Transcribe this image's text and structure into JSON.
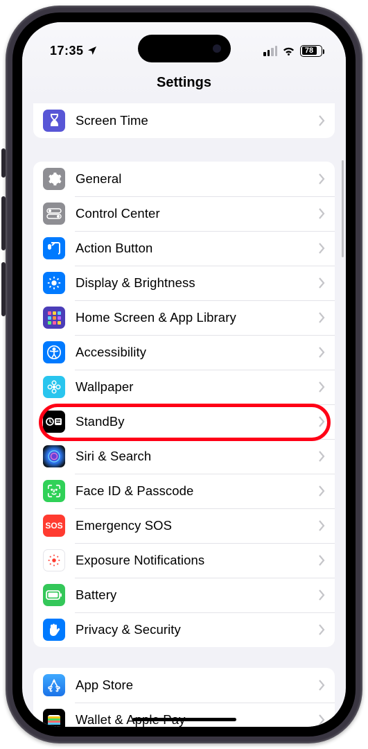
{
  "status": {
    "time": "17:35",
    "battery": "78"
  },
  "header": {
    "title": "Settings"
  },
  "groups": [
    {
      "rows": [
        {
          "icon": "hourglass-icon",
          "bg": "#5856d6",
          "label": "Screen Time"
        }
      ]
    },
    {
      "rows": [
        {
          "icon": "gear-icon",
          "bg": "#8e8e93",
          "label": "General"
        },
        {
          "icon": "switches-icon",
          "bg": "#8e8e93",
          "label": "Control Center"
        },
        {
          "icon": "action-button-icon",
          "bg": "#007aff",
          "label": "Action Button"
        },
        {
          "icon": "sun-icon",
          "bg": "#007aff",
          "label": "Display & Brightness"
        },
        {
          "icon": "app-grid-icon",
          "bg": "#4b3db8",
          "label": "Home Screen & App Library"
        },
        {
          "icon": "accessibility-icon",
          "bg": "#007aff",
          "label": "Accessibility"
        },
        {
          "icon": "flower-icon",
          "bg": "#29c5ee",
          "label": "Wallpaper"
        },
        {
          "icon": "standby-icon",
          "bg": "#000000",
          "label": "StandBy",
          "highlight": true
        },
        {
          "icon": "siri-icon",
          "bg": "#111111",
          "label": "Siri & Search"
        },
        {
          "icon": "faceid-icon",
          "bg": "#30d158",
          "label": "Face ID & Passcode"
        },
        {
          "icon": "sos-icon",
          "bg": "#ff3b30",
          "label": "Emergency SOS"
        },
        {
          "icon": "exposure-icon",
          "bg": "#ffffff",
          "label": "Exposure Notifications"
        },
        {
          "icon": "battery-icon",
          "bg": "#34c759",
          "label": "Battery"
        },
        {
          "icon": "hand-icon",
          "bg": "#007aff",
          "label": "Privacy & Security"
        }
      ]
    },
    {
      "rows": [
        {
          "icon": "appstore-icon",
          "bg": "#1e8fff",
          "label": "App Store"
        },
        {
          "icon": "wallet-icon",
          "bg": "#000000",
          "label": "Wallet & Apple Pay"
        }
      ]
    }
  ]
}
